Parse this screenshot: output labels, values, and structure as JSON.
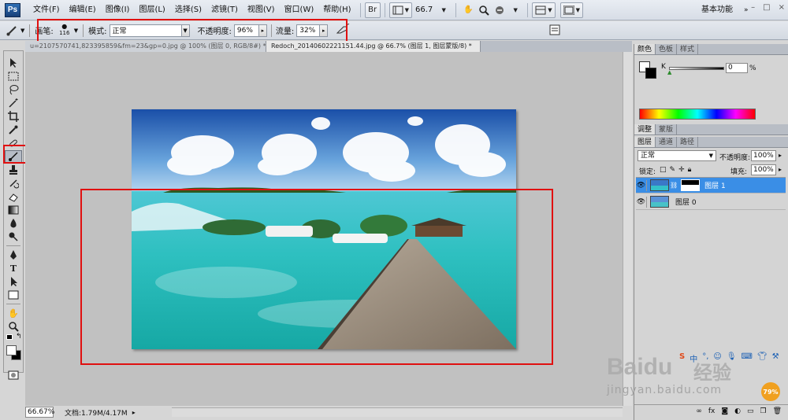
{
  "app": {
    "logo": "Ps",
    "menus": [
      "文件(F)",
      "编辑(E)",
      "图像(I)",
      "图层(L)",
      "选择(S)",
      "滤镜(T)",
      "视图(V)",
      "窗口(W)",
      "帮助(H)"
    ],
    "zoom": "66.7",
    "workspace": "基本功能",
    "window_controls": [
      "–",
      "□",
      "×"
    ]
  },
  "options": {
    "brush_label": "画笔:",
    "brush_size": "116",
    "mode_label": "模式:",
    "mode_value": "正常",
    "opacity_label": "不透明度:",
    "opacity_value": "96%",
    "flow_label": "流量:",
    "flow_value": "32%"
  },
  "documents": {
    "tabs": [
      "u=2107570741,823395859&fm=23&gp=0.jpg @ 100% (图层 0, RGB/8#) *",
      "Redoch_20140602221151.44.jpg @ 66.7% (图层 1, 图层蒙版/8) *"
    ],
    "active_index": 1
  },
  "status": {
    "zoom": "66.67%",
    "doc_size": "文档:1.79M/4.17M"
  },
  "tools": [
    "move-tool",
    "marquee-tool",
    "lasso-tool",
    "magic-wand-tool",
    "crop-tool",
    "eyedropper-tool",
    "healing-tool",
    "brush-tool",
    "clone-stamp-tool",
    "history-brush-tool",
    "eraser-tool",
    "gradient-tool",
    "blur-tool",
    "dodge-tool",
    "pen-tool",
    "type-tool",
    "path-selection-tool",
    "shape-tool",
    "hand-tool",
    "zoom-tool"
  ],
  "color_panel": {
    "tabs": [
      "颜色",
      "色板",
      "样式"
    ],
    "channel_label": "K",
    "value": "0",
    "unit": "%"
  },
  "adjust_panel": {
    "tabs": [
      "调整",
      "蒙版"
    ]
  },
  "layers_panel": {
    "tabs": [
      "图层",
      "通道",
      "路径"
    ],
    "blend_mode": "正常",
    "opacity_label": "不透明度:",
    "opacity_value": "100%",
    "lock_label": "锁定:",
    "fill_label": "填充:",
    "fill_value": "100%",
    "layers": [
      {
        "name": "图层 1",
        "selected": true,
        "has_mask": true
      },
      {
        "name": "图层 0",
        "selected": false,
        "has_mask": false
      }
    ]
  },
  "watermark": {
    "brand": "Baidu",
    "brand_cn": "经验",
    "url": "jingyan.baidu.com",
    "badge": "79%",
    "ime": "中"
  }
}
